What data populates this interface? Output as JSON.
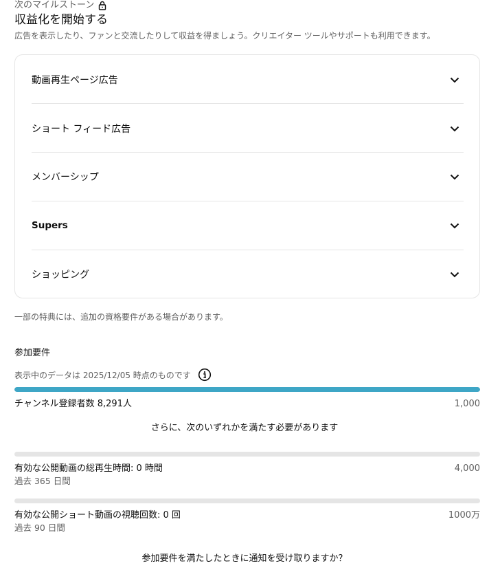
{
  "header": {
    "milestone_label": "次のマイルストーン",
    "title": "収益化を開始する",
    "subtitle": "広告を表示したり、ファンと交流したりして収益を得ましょう。クリエイター ツールやサポートも利用できます。"
  },
  "accordion": {
    "items": [
      {
        "label": "動画再生ページ広告"
      },
      {
        "label": "ショート フィード広告"
      },
      {
        "label": "メンバーシップ"
      },
      {
        "label": "Supers"
      },
      {
        "label": "ショッピング"
      }
    ]
  },
  "perk_note": "一部の特典には、追加の資格要件がある場合があります。",
  "requirements": {
    "title": "参加要件",
    "data_date": "表示中のデータは 2025/12/05 時点のものです",
    "subscribers": {
      "label": "チャンネル登録者数 8,291人",
      "target": "1,000",
      "progress": 1.0
    },
    "or_text": "さらに、次のいずれかを満たす必要があります",
    "watch_hours": {
      "label": "有効な公開動画の総再生時間: 0 時間",
      "target": "4,000",
      "period": "過去 365 日間",
      "progress": 0
    },
    "shorts_views": {
      "label": "有効な公開ショート動画の視聴回数: 0 回",
      "target": "1000万",
      "period": "過去 90 日間",
      "progress": 0
    },
    "notify_question": "参加要件を満たしたときに通知を受け取りますか？"
  },
  "colors": {
    "progress_fill": "#3ea6c6",
    "track": "#e5e5e5",
    "secondary_text": "#606060"
  }
}
